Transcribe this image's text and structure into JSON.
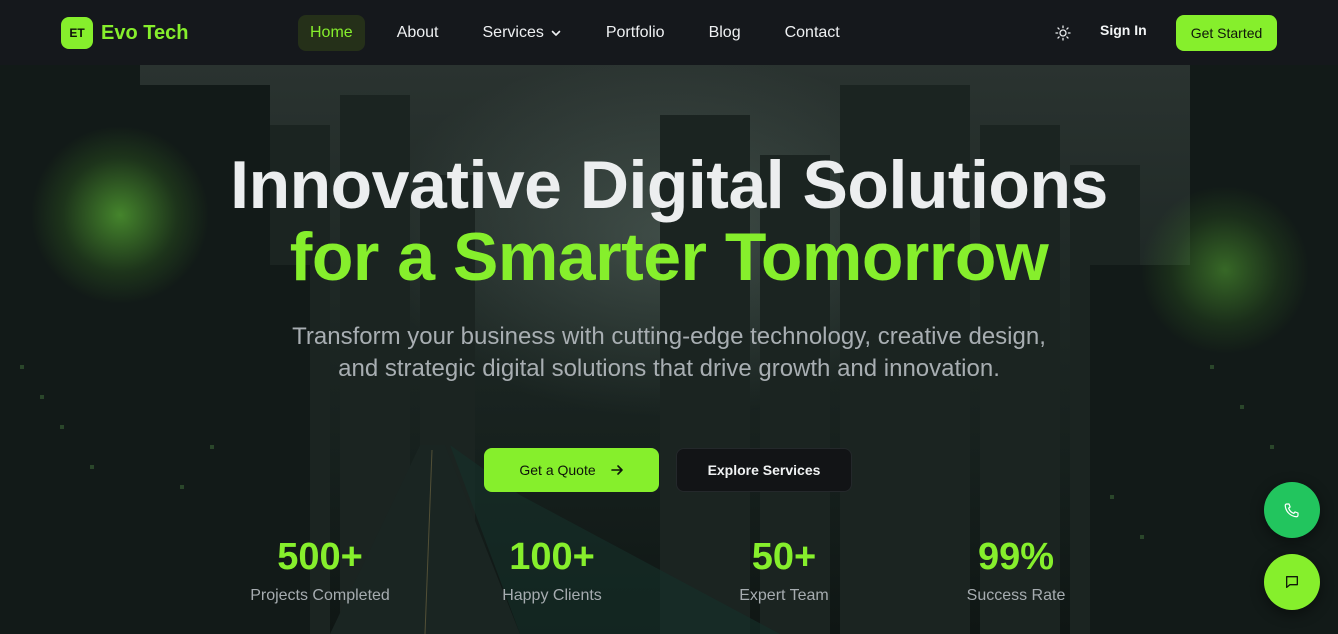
{
  "brand": {
    "mark": "ET",
    "name": "Evo Tech"
  },
  "nav": {
    "items": [
      {
        "label": "Home",
        "active": true
      },
      {
        "label": "About"
      },
      {
        "label": "Services",
        "has_dropdown": true
      },
      {
        "label": "Portfolio"
      },
      {
        "label": "Blog"
      },
      {
        "label": "Contact"
      }
    ],
    "theme_icon": "sun-icon",
    "sign_in": "Sign In",
    "get_started": "Get Started"
  },
  "hero": {
    "title_line1": "Innovative Digital Solutions",
    "title_line2": "for a Smarter Tomorrow",
    "subtitle": "Transform your business with cutting-edge technology, creative design, and strategic digital solutions that drive growth and innovation.",
    "primary_cta": "Get a Quote",
    "primary_cta_icon": "arrow-right-icon",
    "secondary_cta": "Explore Services"
  },
  "stats": [
    {
      "value": "500+",
      "label": "Projects Completed"
    },
    {
      "value": "100+",
      "label": "Happy Clients"
    },
    {
      "value": "50+",
      "label": "Expert Team"
    },
    {
      "value": "99%",
      "label": "Success Rate"
    }
  ],
  "fabs": {
    "call_icon": "phone-icon",
    "chat_icon": "chat-icon"
  },
  "colors": {
    "accent": "#86ef2c",
    "nav_bg": "#15181c",
    "call_green": "#22c55e"
  }
}
